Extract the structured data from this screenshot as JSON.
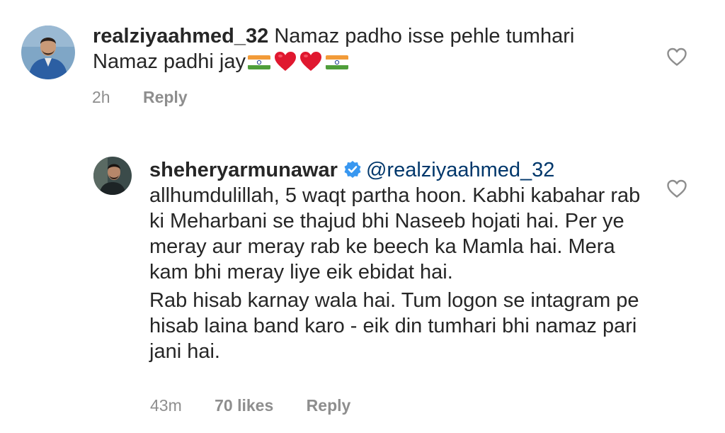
{
  "comments": [
    {
      "username": "realziyaahmed_32",
      "text": "Namaz padho isse pehle tumhari Namaz padhi jay",
      "emojis": [
        "india-flag",
        "red-heart",
        "red-heart",
        "india-flag"
      ],
      "time": "2h",
      "reply_label": "Reply"
    },
    {
      "username": "sheheryarmunawar",
      "verified": true,
      "mention": "@realziyaahmed_32",
      "paragraph1": "allhumdulillah, 5 waqt partha hoon. Kabhi kabahar rab ki Meharbani se thajud bhi Naseeb hojati hai. Per ye meray aur meray rab ke beech ka Mamla hai. Mera kam bhi meray liye eik ebidat hai.",
      "paragraph2": "Rab hisab karnay wala hai. Tum logon se intagram pe hisab laina band karo - eik din tumhari bhi namaz pari jani hai.",
      "time": "43m",
      "likes": "70 likes",
      "reply_label": "Reply"
    }
  ],
  "colors": {
    "text": "#262626",
    "meta": "#8e8e8e",
    "mention": "#00376b",
    "verified": "#3897f0",
    "heart": "#e0182f"
  }
}
